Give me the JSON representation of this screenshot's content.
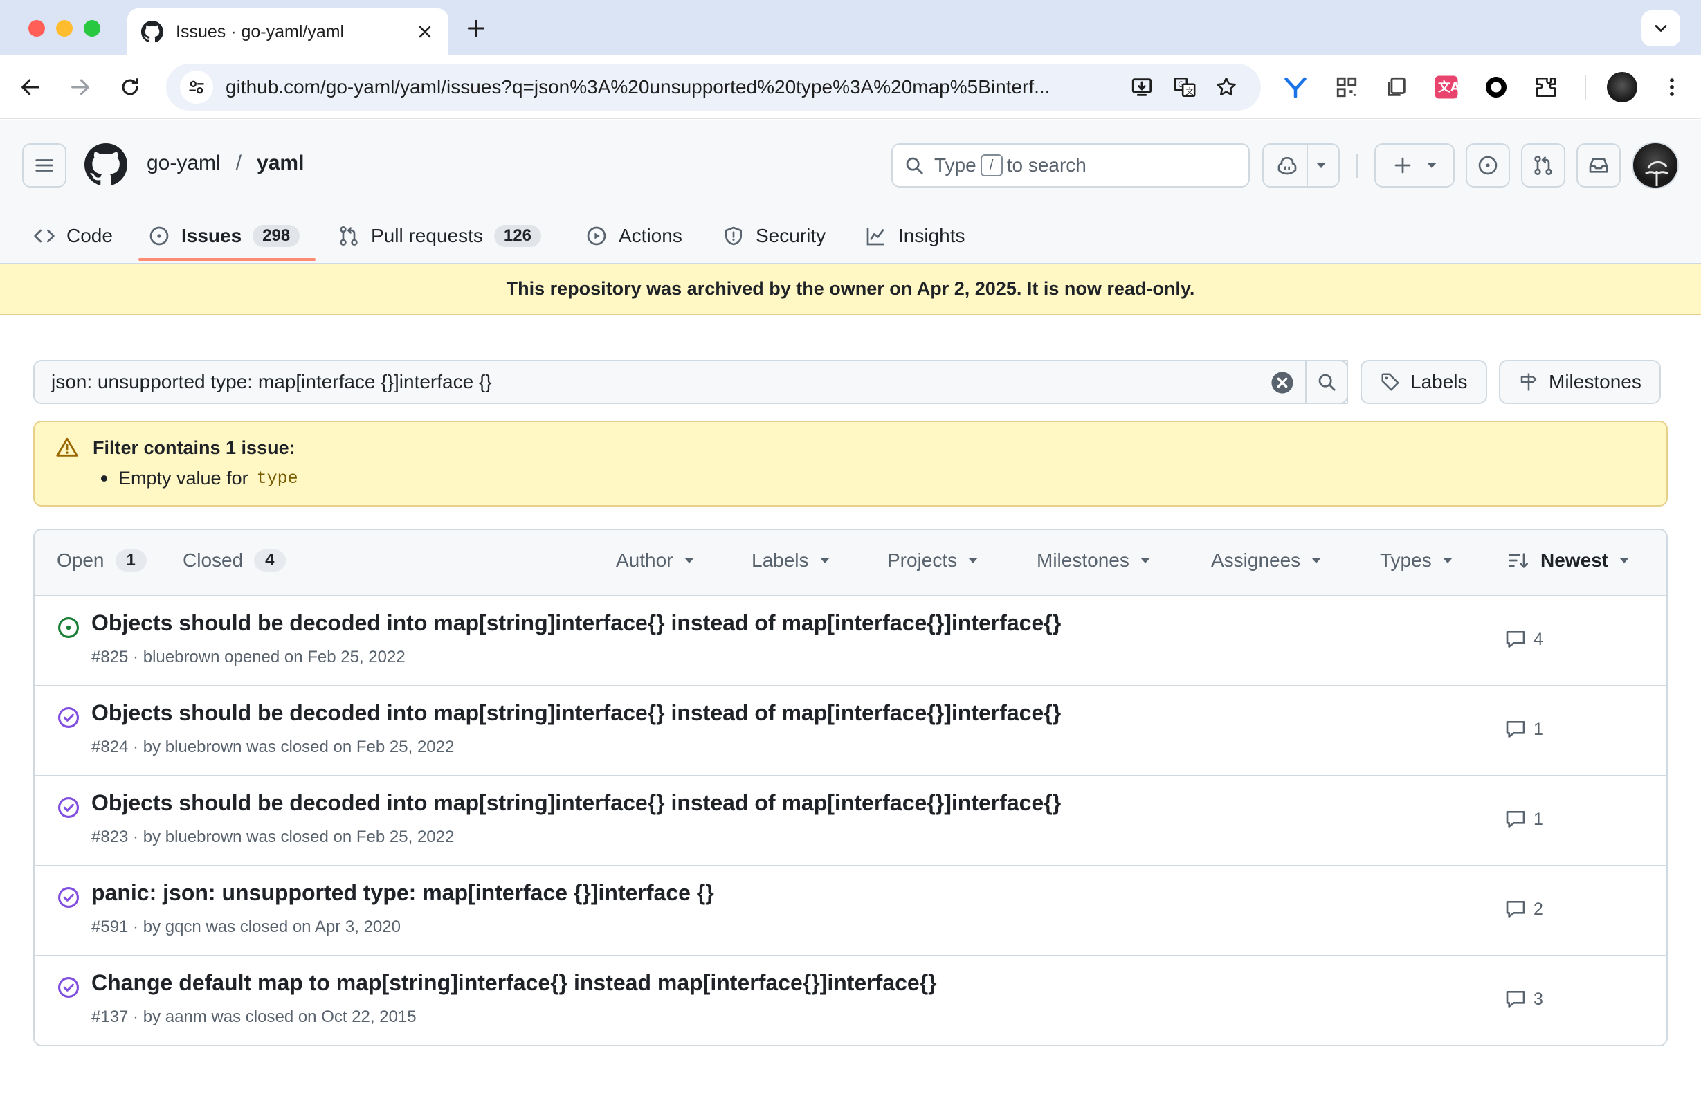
{
  "browser": {
    "tab_title": "Issues · go-yaml/yaml",
    "url": "github.com/go-yaml/yaml/issues?q=json%3A%20unsupported%20type%3A%20map%5Binterf..."
  },
  "header": {
    "owner": "go-yaml",
    "separator": "/",
    "repo": "yaml",
    "search_prefix": "Type",
    "search_key": "/",
    "search_suffix": "to search"
  },
  "repo_nav": {
    "code": "Code",
    "issues": "Issues",
    "issues_count": "298",
    "pulls": "Pull requests",
    "pulls_count": "126",
    "actions": "Actions",
    "security": "Security",
    "insights": "Insights"
  },
  "archived_banner": "This repository was archived by the owner on Apr 2, 2025. It is now read-only.",
  "filter": {
    "query": "json: unsupported type: map[interface {}]interface {}",
    "labels_button": "Labels",
    "milestones_button": "Milestones"
  },
  "warning": {
    "title": "Filter contains 1 issue:",
    "item_text": "Empty value for",
    "item_code": "type"
  },
  "list_header": {
    "open_label": "Open",
    "open_count": "1",
    "closed_label": "Closed",
    "closed_count": "4",
    "filters": [
      "Author",
      "Labels",
      "Projects",
      "Milestones",
      "Assignees",
      "Types"
    ],
    "sort": "Newest"
  },
  "issues": [
    {
      "state": "open",
      "title": "Objects should be decoded into map[string]interface{} instead of map[interface{}]interface{}",
      "meta": "#825 · bluebrown opened on Feb 25, 2022",
      "comments": "4"
    },
    {
      "state": "closed",
      "title": "Objects should be decoded into map[string]interface{} instead of map[interface{}]interface{}",
      "meta": "#824 · by bluebrown was closed on Feb 25, 2022",
      "comments": "1"
    },
    {
      "state": "closed",
      "title": "Objects should be decoded into map[string]interface{} instead of map[interface{}]interface{}",
      "meta": "#823 · by bluebrown was closed on Feb 25, 2022",
      "comments": "1"
    },
    {
      "state": "closed",
      "title": "panic: json: unsupported type: map[interface {}]interface {}",
      "meta": "#591 · by gqcn was closed on Apr 3, 2020",
      "comments": "2"
    },
    {
      "state": "closed",
      "title": "Change default map to map[string]interface{} instead map[interface{}]interface{}",
      "meta": "#137 · by aanm was closed on Oct 22, 2015",
      "comments": "3"
    }
  ],
  "colors": {
    "open": "#1a7f37",
    "closed": "#8250df",
    "banner": "#fff8c5",
    "tab_underline": "#fd8c73"
  },
  "icons": {
    "issue_open": "issue-opened-icon",
    "issue_closed": "issue-closed-icon",
    "comment": "comment-icon"
  }
}
